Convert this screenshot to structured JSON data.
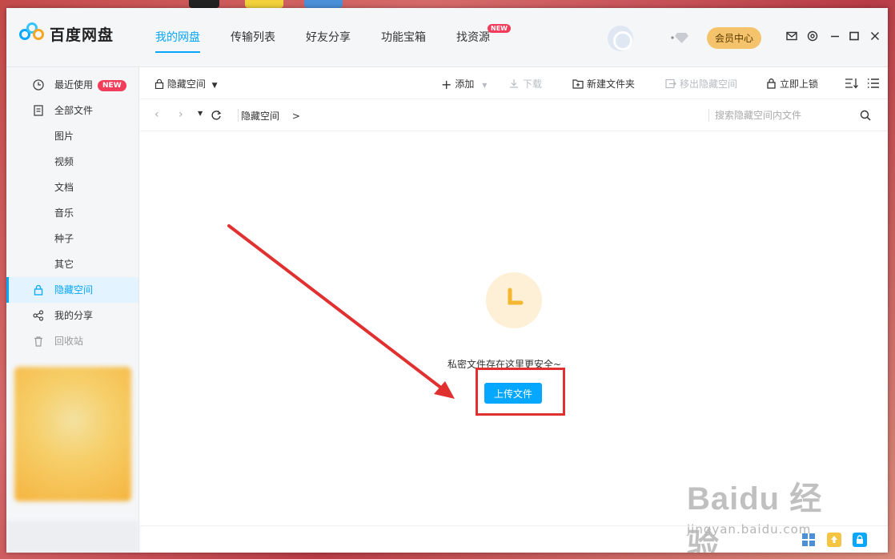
{
  "app": {
    "brand": "百度网盘",
    "colors": {
      "accent": "#06a7ff",
      "badge": "#f23c5a",
      "vip": "#f5c36b",
      "highlight": "#e03030"
    }
  },
  "header": {
    "nav": [
      {
        "label": "我的网盘",
        "active": true
      },
      {
        "label": "传输列表",
        "active": false
      },
      {
        "label": "好友分享",
        "active": false
      },
      {
        "label": "功能宝箱",
        "active": false
      },
      {
        "label": "找资源",
        "active": false,
        "badge": "NEW"
      }
    ],
    "vip_label": "会员中心",
    "icons": [
      "mail-icon",
      "settings-icon",
      "minimize-icon",
      "maximize-icon",
      "close-icon"
    ]
  },
  "sidebar": {
    "items": [
      {
        "label": "最近使用",
        "icon": "clock-icon",
        "badge": "NEW"
      },
      {
        "label": "全部文件",
        "icon": "document-icon"
      },
      {
        "label": "图片",
        "sub": true
      },
      {
        "label": "视频",
        "sub": true
      },
      {
        "label": "文档",
        "sub": true
      },
      {
        "label": "音乐",
        "sub": true
      },
      {
        "label": "种子",
        "sub": true
      },
      {
        "label": "其它",
        "sub": true
      },
      {
        "label": "隐藏空间",
        "icon": "lock-icon",
        "active": true
      },
      {
        "label": "我的分享",
        "icon": "share-icon"
      },
      {
        "label": "回收站",
        "icon": "trash-icon"
      }
    ]
  },
  "toolbar": {
    "space_dropdown": "隐藏空间",
    "add": "添加",
    "download": "下载",
    "new_folder": "新建文件夹",
    "move_out": "移出隐藏空间",
    "lock_now": "立即上锁"
  },
  "breadcrumb": {
    "path": "隐藏空间",
    "separator": ">",
    "search_placeholder": "搜索隐藏空间内文件"
  },
  "main": {
    "empty_message": "私密文件存在这里更安全~",
    "upload_label": "上传文件"
  },
  "watermark": {
    "text": "jingyan.baidu.com",
    "brand": "Baidu 经验"
  }
}
